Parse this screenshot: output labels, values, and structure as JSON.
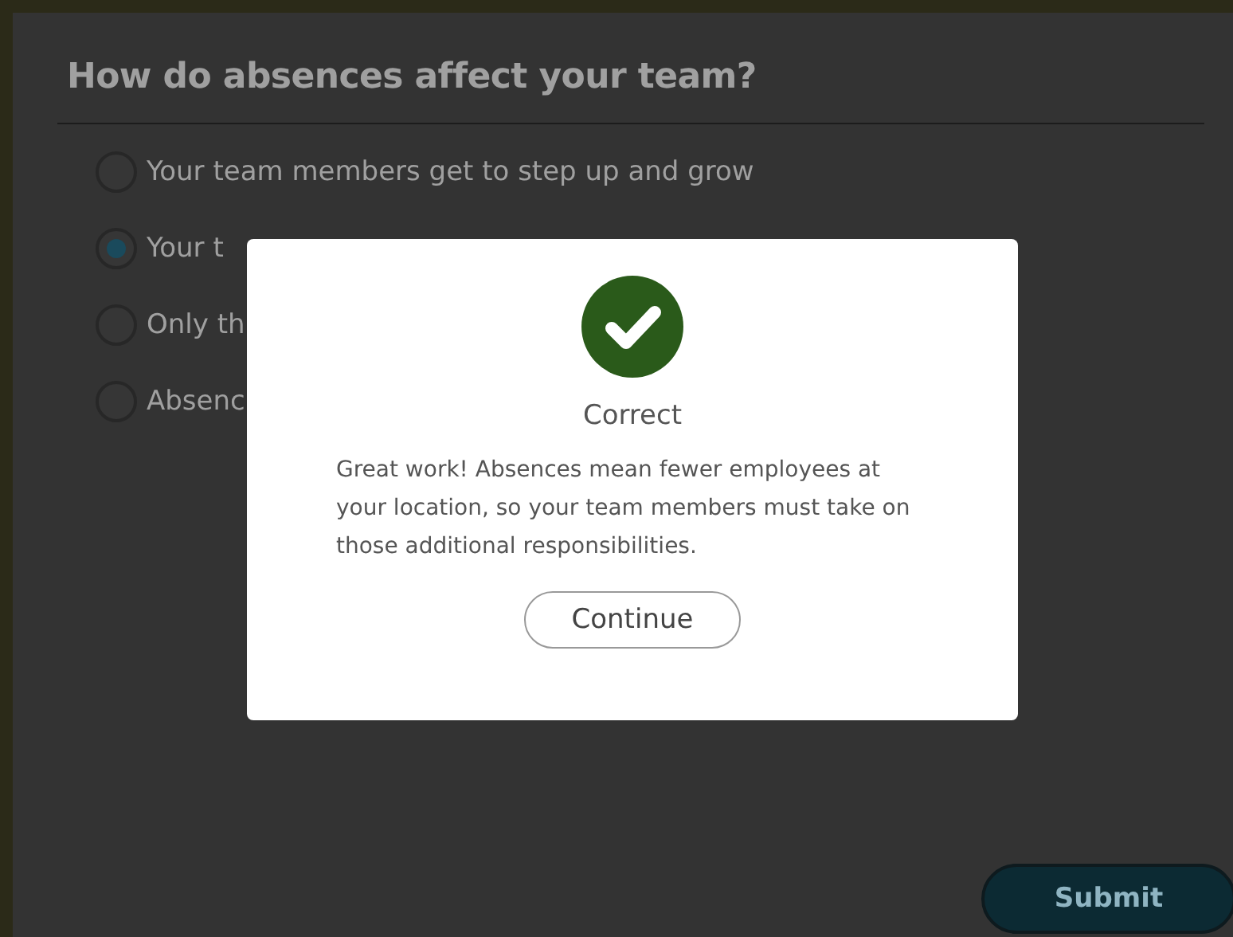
{
  "question": {
    "title": "How do absences affect your team?",
    "options": [
      {
        "label": "Your team members get to step up and grow",
        "selected": false
      },
      {
        "label": "Your t",
        "selected": true
      },
      {
        "label": "Only th",
        "selected": false
      },
      {
        "label": "Absenc",
        "selected": false
      }
    ],
    "submit": {
      "label": "Submit",
      "disabled": true
    }
  },
  "feedback_dialog": {
    "kind": "correct",
    "title": "Correct",
    "message": "Great work!  Absences mean fewer employees at your location, so your team members must take on those additional responsibilities.",
    "button": "Continue"
  }
}
